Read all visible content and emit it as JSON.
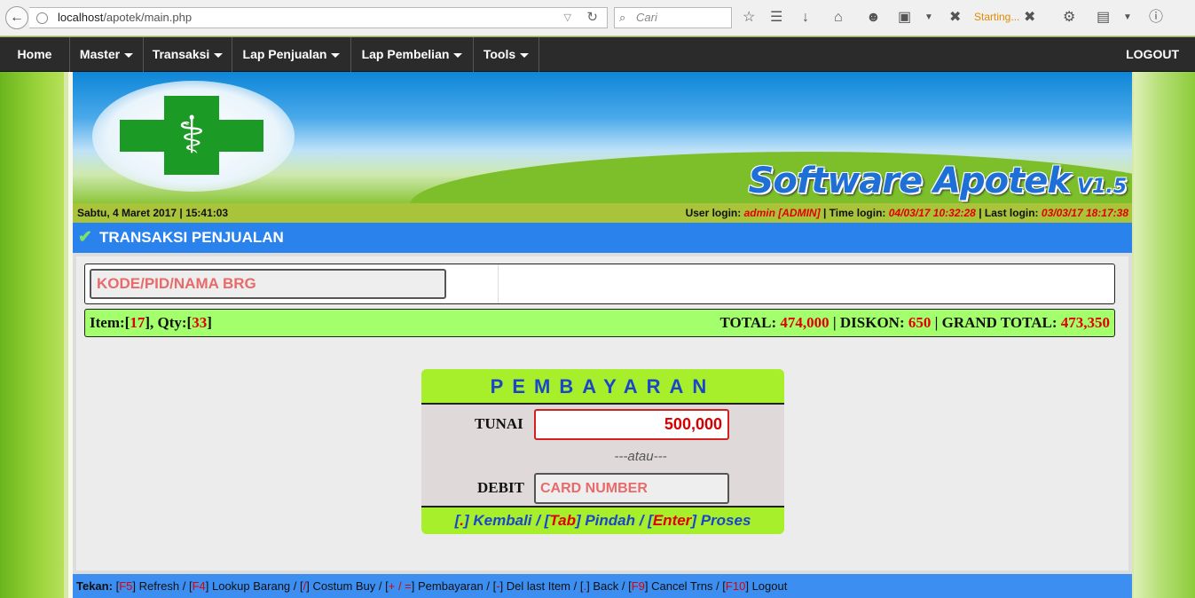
{
  "browser": {
    "url_host": "localhost",
    "url_path": "/apotek/main.php",
    "search_placeholder": "Cari",
    "status_text": "Starting...",
    "icons": [
      "back-arrow-icon",
      "star-icon",
      "reader-icon",
      "download-icon",
      "home-icon",
      "chat-icon",
      "camera-icon",
      "x-icon",
      "extension-icon",
      "clipboard-icon",
      "info-icon"
    ]
  },
  "nav": {
    "items": [
      "Home",
      "Master",
      "Transaksi",
      "Lap Penjualan",
      "Lap Pembelian",
      "Tools"
    ],
    "logout": "LOGOUT"
  },
  "banner": {
    "brand_name": "Software Apotek",
    "brand_version": "V1.5"
  },
  "status": {
    "datetime": "Sabtu, 4 Maret 2017 | 15:41:03",
    "user_label": "User login:",
    "user_value": "admin [ADMIN]",
    "time_label": "| Time login:",
    "time_value": "04/03/17 10:32:28",
    "last_label": "| Last login:",
    "last_value": "03/03/17 18:17:38"
  },
  "section": {
    "title": "TRANSAKSI PENJUALAN"
  },
  "transaction": {
    "kode_placeholder": "KODE/PID/NAMA BRG",
    "item_label": "Item:[",
    "item_count": "17",
    "qty_label": "], Qty:[",
    "qty_count": "33",
    "qty_close": "]",
    "total_label": "TOTAL:",
    "total_value": "474,000",
    "diskon_label": "| DISKON:",
    "diskon_value": "650",
    "grand_label": "| GRAND TOTAL:",
    "grand_value": "473,350"
  },
  "payment": {
    "heading": "PEMBAYARAN",
    "tunai_label": "TUNAI",
    "tunai_value": "500,000",
    "atau": "---atau---",
    "debit_label": "DEBIT",
    "debit_placeholder": "CARD NUMBER",
    "hint_1_open": "[",
    "hint_1_key": ".",
    "hint_1_text": "] Kembali / [",
    "hint_2_key": "Tab",
    "hint_2_text": "] Pindah / [",
    "hint_3_key": "Enter",
    "hint_3_text": "] Proses"
  },
  "footer": {
    "label": "Tekan:",
    "shortcuts": [
      {
        "key": "F5",
        "text": "Refresh /"
      },
      {
        "key": "F4",
        "text": "Lookup Barang /"
      },
      {
        "key": "/",
        "text": "Costum Buy /"
      },
      {
        "key": "+ / =",
        "text": "Pembayaran /"
      },
      {
        "key": "-",
        "text": "Del last Item /"
      },
      {
        "key": ".",
        "text": "Back /"
      },
      {
        "key": "F9",
        "text": "Cancel Trns /"
      },
      {
        "key": "F10",
        "text": "Logout"
      }
    ]
  },
  "colors": {
    "accent_blue": "#2a82ec",
    "nav_bg": "#2b2b2b",
    "summary_green": "#a3ff6b",
    "pay_green": "#a7ef2a",
    "error_red": "#e00000"
  }
}
